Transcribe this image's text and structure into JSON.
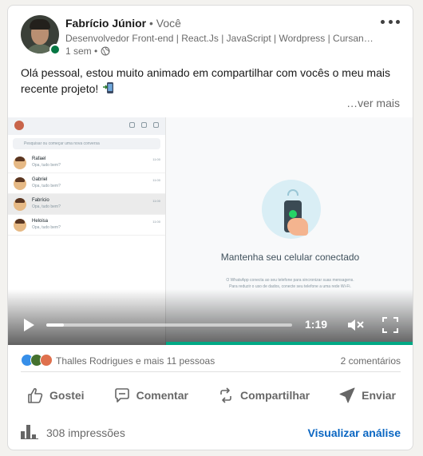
{
  "post": {
    "author_name": "Fabrício Júnior",
    "degree": " • Você",
    "headline": "Desenvolvedor Front-end | React.Js | JavaScript | Wordpress | Cursando...",
    "time": "1 sem •",
    "visibility_icon": "globe-icon",
    "text": "Olá pessoal, estou muito animado em compartilhar com vocês o meu mais recente projeto!",
    "text_emoji_icon": "mobile-phone-arrow-icon",
    "see_more": "…ver mais"
  },
  "video": {
    "search_placeholder": "Pesquisar ou começar uma nova conversa",
    "chats": [
      {
        "name": "Rafael",
        "message": "Opa, tudo bem?",
        "time": "11:00"
      },
      {
        "name": "Gabriel",
        "message": "Opa, tudo bem?",
        "time": "11:00"
      },
      {
        "name": "Fabrício",
        "message": "Opa, tudo bem?",
        "time": "11:00"
      },
      {
        "name": "Heloisa",
        "message": "Opa, tudo bem?",
        "time": "11:00"
      }
    ],
    "main_title": "Mantenha seu celular conectado",
    "main_subtitle_1": "O WhatsApp conecta ao seu telefone para sincronizar suas mensagens.",
    "main_subtitle_2": "Para reduzir o uso de dados, conecte seu telefone a uma rede Wi-Fi.",
    "elapsed_fraction": 0.07,
    "time_remaining": "1:19"
  },
  "social": {
    "reactors": "Thalles Rodrigues e mais 11 pessoas",
    "comments": "2 comentários"
  },
  "actions": {
    "like": "Gostei",
    "comment": "Comentar",
    "share": "Compartilhar",
    "send": "Enviar"
  },
  "footer": {
    "impressions": "308 impressões",
    "analytics": "Visualizar análise"
  },
  "colors": {
    "brand_blue": "#0a66c2",
    "online_green": "#057642",
    "whatsapp_green": "#00a884"
  }
}
